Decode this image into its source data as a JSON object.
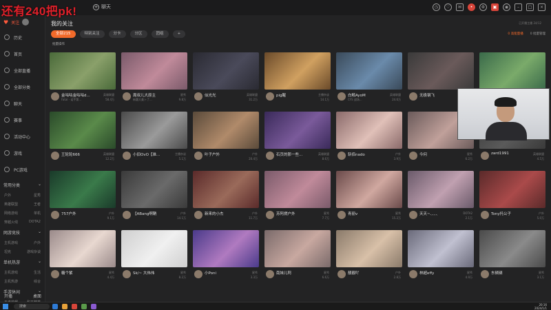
{
  "overlay": {
    "title": "还有240把pk!"
  },
  "topbar": {
    "chat_label": "聊天"
  },
  "sidebar": {
    "follow_label": "关注",
    "items": [
      {
        "label": "历史",
        "icon": "history-icon"
      },
      {
        "label": "首页",
        "icon": "home-icon"
      },
      {
        "label": "全部直播",
        "icon": "live-icon"
      },
      {
        "label": "全部分类",
        "icon": "category-icon"
      },
      {
        "label": "聊天",
        "icon": "chat-icon"
      },
      {
        "label": "赛事",
        "icon": "trophy-icon"
      },
      {
        "label": "活动中心",
        "icon": "gift-icon"
      },
      {
        "label": "游戏",
        "icon": "game-icon"
      },
      {
        "label": "PC游戏",
        "icon": "pc-icon"
      }
    ],
    "sections": [
      {
        "title": "常用分类",
        "subs": [
          "户外",
          "星秀",
          "英雄联盟",
          "王者",
          "网络游戏",
          "单机",
          "穿越火线",
          "DOTA2"
        ]
      },
      {
        "title": "网游竞技",
        "subs": [
          "主机游戏",
          "户外",
          "坦克",
          "游戏杂谈"
        ]
      },
      {
        "title": "单机热游",
        "subs": [
          "主机游戏",
          "生活",
          "主机热游",
          "综合"
        ]
      },
      {
        "title": "手游休闲",
        "subs": [
          "王者荣耀",
          "和平精英"
        ]
      }
    ],
    "bottom_left": "开播",
    "bottom_right": "桌面"
  },
  "main": {
    "title": "我的关注",
    "top_hint": "已开播主播 24/12",
    "filters": [
      "全部215",
      "特别关注",
      "分卡",
      "分区",
      "团组",
      "+"
    ],
    "active_filter": 0,
    "right_links": {
      "a": "0 高能量播",
      "b": "0 批量管理"
    },
    "batch_label": "批量操作"
  },
  "cards": [
    {
      "name": "金咕咕金咕咕d...",
      "cat": "英雄联盟",
      "sub": "Fatal · 诺手第...",
      "pop": "58.4万",
      "c1": "#4a6a3a",
      "c2": "#8aa06a"
    },
    {
      "name": "周叔儿大原主",
      "cat": "星秀",
      "sub": "新疆大美卜了...",
      "pop": "9.8万",
      "c1": "#7a5a6a",
      "c2": "#c08a9a"
    },
    {
      "name": "似光光",
      "cat": "英雄联盟",
      "sub": "",
      "pop": "31.2万",
      "c1": "#2a2a32",
      "c2": "#4a4a5a"
    },
    {
      "name": "pig醒",
      "cat": "主播杂谈",
      "sub": "",
      "pop": "14.1万",
      "c1": "#6a4a2a",
      "c2": "#d0a060"
    },
    {
      "name": "白鲸AyoM",
      "cat": "英雄联盟",
      "sub": "CFS 战场...",
      "pop": "24.6万",
      "c1": "#3a4a5a",
      "c2": "#6a8aaa"
    },
    {
      "name": "无极钢飞",
      "cat": "户外",
      "sub": "",
      "pop": "7.3万",
      "c1": "#3a3a3a",
      "c2": "#6a5a5a"
    },
    {
      "name": "",
      "cat": "",
      "sub": "",
      "pop": "",
      "c1": "#3a6a4a",
      "c2": "#7aaa6a"
    },
    {
      "name": "王轮轮666",
      "cat": "英雄联盟",
      "sub": "",
      "pop": "12.2万",
      "c1": "#2a4a2a",
      "c2": "#5a8a4a"
    },
    {
      "name": "小旧OvO【准...",
      "cat": "主播杂谈",
      "sub": "",
      "pop": "5.1万",
      "c1": "#4a4a4a",
      "c2": "#9a9a9a"
    },
    {
      "name": "叶子户外",
      "cat": "户外",
      "sub": "",
      "pop": "20.4万",
      "c1": "#5a4a3a",
      "c2": "#b08a6a"
    },
    {
      "name": "石页的那一些...",
      "cat": "英雄联盟",
      "sub": "",
      "pop": "8.6万",
      "c1": "#3a2a5a",
      "c2": "#7a5a9a"
    },
    {
      "name": "斩佰nado",
      "cat": "户外",
      "sub": "",
      "pop": "3.9万",
      "c1": "#8a6a6a",
      "c2": "#e0c0b8"
    },
    {
      "name": "今何",
      "cat": "星秀",
      "sub": "",
      "pop": "6.2万",
      "c1": "#6a5a5a",
      "c2": "#c0a09a"
    },
    {
      "name": "zard1991",
      "cat": "英雄联盟",
      "sub": "",
      "pop": "4.5万",
      "c1": "#3a3a3a",
      "c2": "#5a5a5a"
    },
    {
      "name": "757户外",
      "cat": "户外",
      "sub": "",
      "pop": "9.1万",
      "c1": "#1a3a2a",
      "c2": "#3a7a4a"
    },
    {
      "name": "【ABang啊鞘",
      "cat": "户外",
      "sub": "",
      "pop": "14.1万",
      "c1": "#3a3a3a",
      "c2": "#6a6a6a"
    },
    {
      "name": "新来的小杰",
      "cat": "户外",
      "sub": "",
      "pop": "11.7万",
      "c1": "#5a2a2a",
      "c2": "#9a6a5a"
    },
    {
      "name": "苏阿燃户外",
      "cat": "星秀",
      "sub": "",
      "pop": "7.7万",
      "c1": "#7a5a6a",
      "c2": "#c08a9a"
    },
    {
      "name": "青丽v",
      "cat": "星秀",
      "sub": "",
      "pop": "15.2万",
      "c1": "#6a4a4a",
      "c2": "#d0a8a0"
    },
    {
      "name": "天天~、、、、",
      "cat": "DOTA2",
      "sub": "",
      "pop": "2.1万",
      "c1": "#6a5a6a",
      "c2": "#c0a0b0"
    },
    {
      "name": "Tony托公子",
      "cat": "户外",
      "sub": "",
      "pop": "5.0万",
      "c1": "#5a2a2a",
      "c2": "#aa4a4a"
    },
    {
      "name": "糖个紫",
      "cat": "星秀",
      "sub": "",
      "pop": "4.4万",
      "c1": "#9a8a8a",
      "c2": "#e8d8d0"
    },
    {
      "name": "Sk/~ 大伟伟",
      "cat": "星秀",
      "sub": "",
      "pop": "8.2万",
      "c1": "#cfcfcf",
      "c2": "#f0f0f0"
    },
    {
      "name": "小Poni",
      "cat": "星秀",
      "sub": "",
      "pop": "3.3万",
      "c1": "#4a3a8a",
      "c2": "#b07ac0"
    },
    {
      "name": "南妹儿阿",
      "cat": "星秀",
      "sub": "",
      "pop": "6.6万",
      "c1": "#7a6a6a",
      "c2": "#c8a8a0"
    },
    {
      "name": "靓靓吖",
      "cat": "户外",
      "sub": "",
      "pop": "2.8万",
      "c1": "#8a7a6a",
      "c2": "#d8c0a8"
    },
    {
      "name": "林超effy",
      "cat": "星秀",
      "sub": "",
      "pop": "4.9万",
      "c1": "#6a6a7a",
      "c2": "#c0c0d0"
    },
    {
      "name": "东辆辆",
      "cat": "星秀",
      "sub": "",
      "pop": "3.1万",
      "c1": "#4a4a4a",
      "c2": "#8a8a8a"
    }
  ],
  "taskbar": {
    "search": "搜索",
    "time": "20:16",
    "date": "2024/1/1"
  }
}
